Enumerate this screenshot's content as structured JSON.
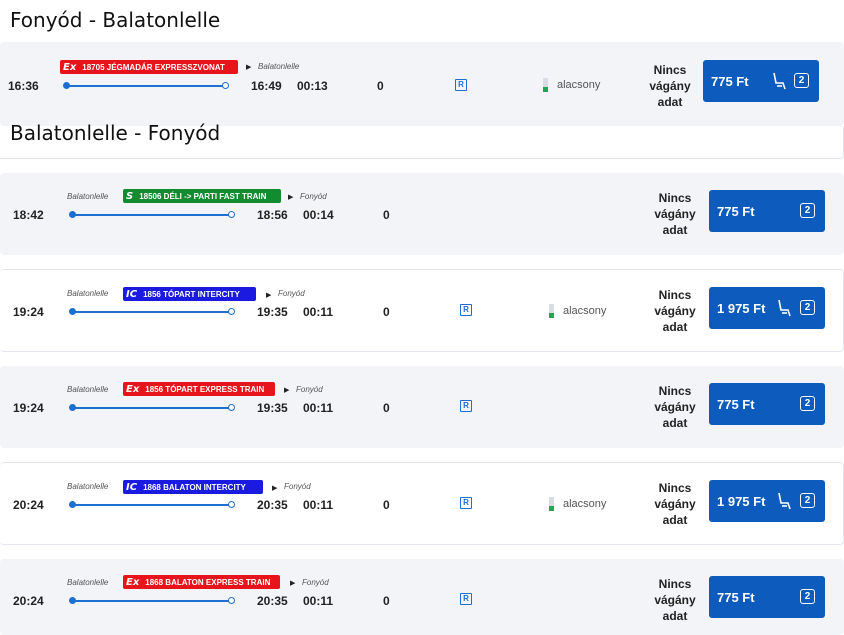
{
  "outbound": {
    "title": "Fonyód - Balatonlelle",
    "trips": [
      {
        "dep": "16:36",
        "arr": "16:49",
        "duration": "00:13",
        "changes": "0",
        "train_logo": "Ex",
        "train_name": "18705 JÉGMADÁR EXPRESSZVONAT",
        "train_color": "#e8141b",
        "to": "Balatonlelle",
        "load": "alacsony",
        "platform": [
          "Nincs",
          "vágány",
          "adat"
        ],
        "price": "775 Ft",
        "class": "2"
      }
    ]
  },
  "return": {
    "title": "Balatonlelle - Fonyód",
    "trips": [
      {
        "from": "Balatonlelle",
        "to": "Fonyód",
        "dep": "18:42",
        "arr": "18:56",
        "duration": "00:14",
        "changes": "0",
        "train_logo": "S",
        "train_name": "18506 DÉLI -> PARTI FAST TRAIN",
        "train_color": "#138b2f",
        "platform": [
          "Nincs",
          "vágány",
          "adat"
        ],
        "price": "775 Ft",
        "class": "2"
      },
      {
        "from": "Balatonlelle",
        "to": "Fonyód",
        "dep": "19:24",
        "arr": "19:35",
        "duration": "00:11",
        "changes": "0",
        "train_logo": "IC",
        "train_name": "1856 TÓPART INTERCITY",
        "train_color": "#1a1ae0",
        "load": "alacsony",
        "platform": [
          "Nincs",
          "vágány",
          "adat"
        ],
        "price": "1 975 Ft",
        "class": "2"
      },
      {
        "from": "Balatonlelle",
        "to": "Fonyód",
        "dep": "19:24",
        "arr": "19:35",
        "duration": "00:11",
        "changes": "0",
        "train_logo": "Ex",
        "train_name": "1856 TÓPART EXPRESS TRAIN",
        "train_color": "#e8141b",
        "platform": [
          "Nincs",
          "vágány",
          "adat"
        ],
        "price": "775 Ft",
        "class": "2"
      },
      {
        "from": "Balatonlelle",
        "to": "Fonyód",
        "dep": "20:24",
        "arr": "20:35",
        "duration": "00:11",
        "changes": "0",
        "train_logo": "IC",
        "train_name": "1868 BALATON INTERCITY",
        "train_color": "#1a1ae0",
        "load": "alacsony",
        "platform": [
          "Nincs",
          "vágány",
          "adat"
        ],
        "price": "1 975 Ft",
        "class": "2"
      },
      {
        "from": "Balatonlelle",
        "to": "Fonyód",
        "dep": "20:24",
        "arr": "20:35",
        "duration": "00:11",
        "changes": "0",
        "train_logo": "Ex",
        "train_name": "1868 BALATON EXPRESS TRAIN",
        "train_color": "#e8141b",
        "platform": [
          "Nincs",
          "vágány",
          "adat"
        ],
        "price": "775 Ft",
        "class": "2"
      }
    ]
  },
  "icons": {
    "reservation": "reservation-r-icon",
    "seat": "seat-icon",
    "class": "second-class-icon",
    "arrow": "play-arrow-icon"
  },
  "colors": {
    "accent": "#0d5bbd",
    "load_low": "#23a455"
  }
}
